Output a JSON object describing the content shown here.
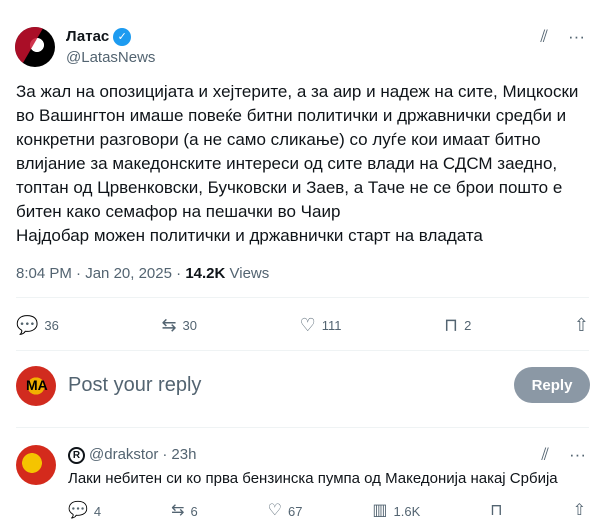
{
  "author": {
    "name": "Латас",
    "handle": "@LatasNews"
  },
  "tweet": {
    "text": "За жал на опозицијата и хејтерите, а за аир и надеж на сите, Мицкоски\nво Вашингтон имаше повеќе битни политички и државнички средби и\nконкретни разговори (а не само сликање) со луѓе кои имаат битно\nвлијание за македонските интереси од сите влади на СДСМ заедно,\nтоптан од Црвенковски, Бучковски и Заев, а Таче не се брои пошто е\nбитен како семафор на пешачки во Чаир\nНајдобар можен политички и државнички старт на владата",
    "time": "8:04 PM",
    "date": "Jan 20, 2025",
    "views": "14.2K",
    "views_label": "Views",
    "stats": {
      "replies": "36",
      "reposts": "30",
      "likes": "111",
      "bookmarks": "2"
    }
  },
  "composer": {
    "placeholder": "Post your reply",
    "button": "Reply",
    "avatar_text": "MA"
  },
  "reply": {
    "handle": "@drakstor",
    "time": "23h",
    "text": "Лаки небитен си ко прва бензинска пумпа од Македонија накај Србија",
    "stats": {
      "replies": "4",
      "reposts": "6",
      "likes": "67",
      "views": "1.6K"
    }
  },
  "icons": {
    "grok": "grok-icon",
    "more": "more-icon",
    "reply": "reply-icon",
    "repost": "repost-icon",
    "like": "heart-icon",
    "bookmark": "bookmark-icon",
    "share": "share-icon",
    "views": "views-icon"
  }
}
